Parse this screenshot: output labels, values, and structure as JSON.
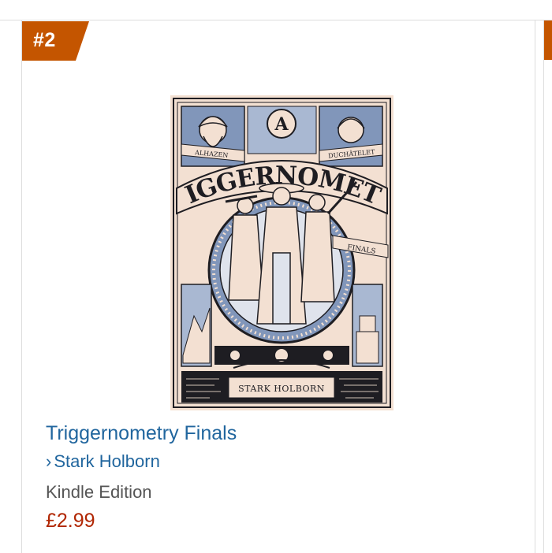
{
  "product": {
    "rank": "#2",
    "title": "Triggernometry Finals",
    "author_chevron": "›",
    "author": "Stark Holborn",
    "format": "Kindle Edition",
    "price": "£2.99"
  },
  "cover": {
    "series_title": "TRIGGERNOMETRY",
    "subtitle": "FINALS",
    "author_plate": "STARK HOLBORN",
    "portrait_left_name": "ALHAZEN",
    "portrait_right_name": "DUCHÂTELET",
    "emblem_letter": "A"
  },
  "colors": {
    "rank_badge": "#c45500",
    "link": "#21669e",
    "price": "#b12704",
    "format_text": "#555555",
    "cover_bg": "#f3e0d2",
    "cover_blue": "#8196ba",
    "cover_ink": "#1e1d22"
  },
  "icons": {
    "author_link": "chevron-right-icon"
  }
}
